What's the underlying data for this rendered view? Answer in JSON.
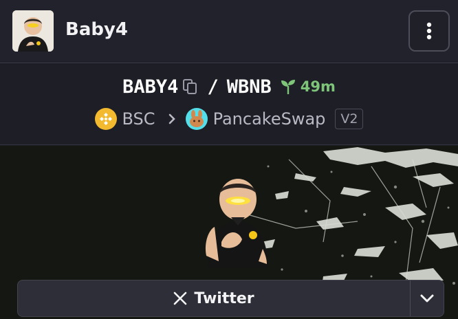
{
  "header": {
    "token_name": "Baby4",
    "avatar_icon": "baby-avatar",
    "menu_icon": "kebab-menu-icon"
  },
  "pair": {
    "base_symbol": "BABY4",
    "quote_symbol": "WBNB",
    "separator": "/",
    "age": "49m",
    "age_icon": "seedling-icon"
  },
  "chain": {
    "network": "BSC",
    "dex": "PancakeSwap",
    "version": "V2",
    "network_icon": "bnb-chain-icon",
    "dex_icon": "pancakeswap-bunny-icon"
  },
  "links": {
    "twitter_label": "Twitter",
    "twitter_icon": "x-logo-icon",
    "more_icon": "chevron-down-icon"
  },
  "colors": {
    "age_green": "#7ec57a",
    "bnb_yellow": "#f3ba2f",
    "cake_teal": "#53dee9"
  }
}
